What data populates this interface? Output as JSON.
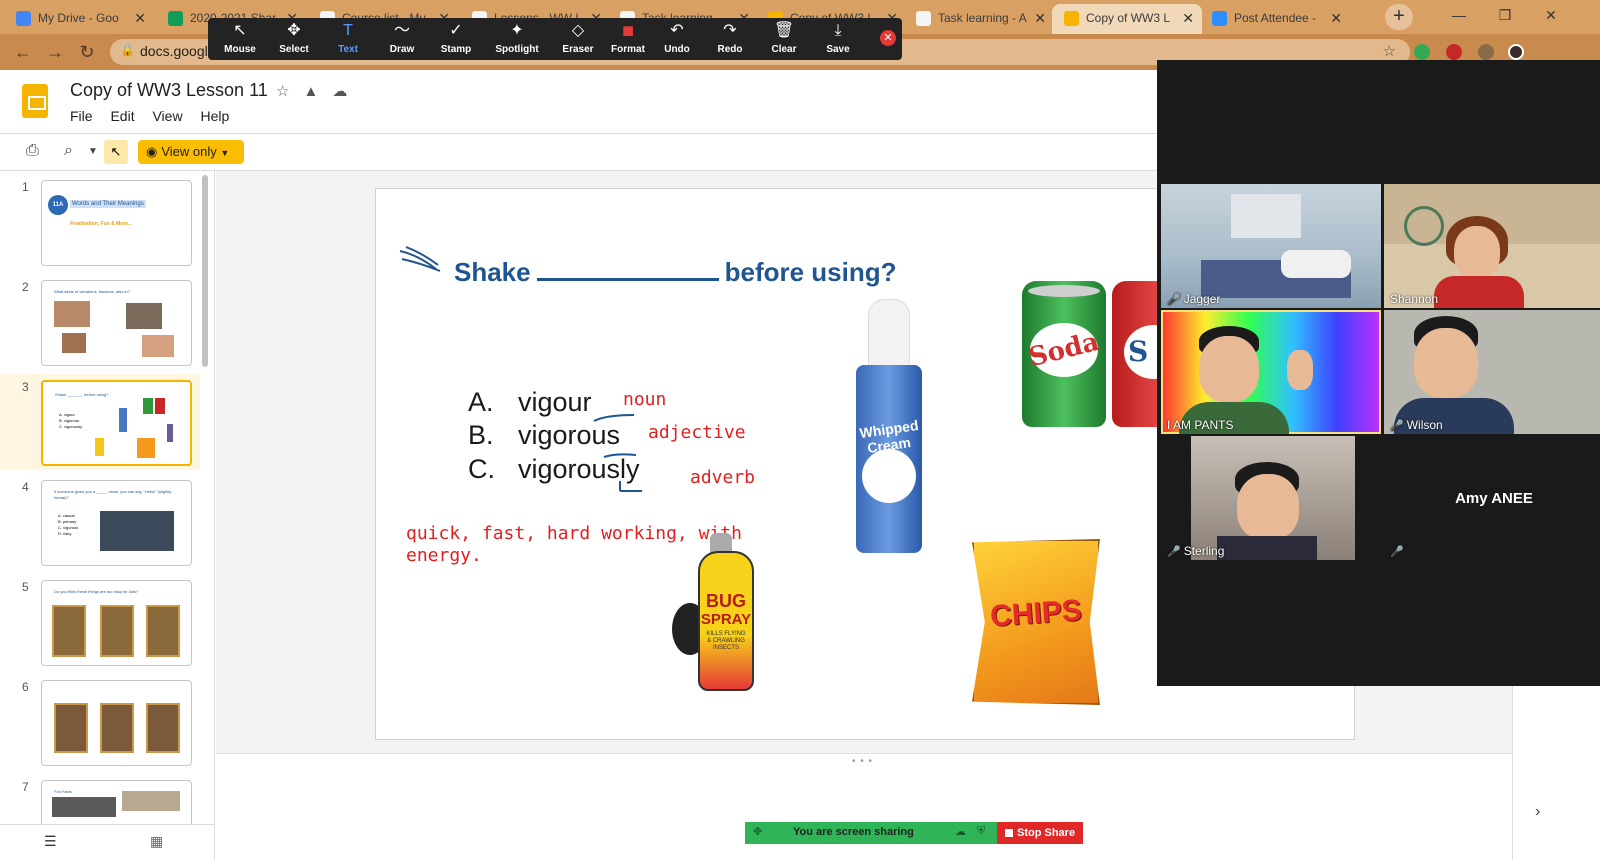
{
  "browser": {
    "tabs": [
      {
        "title": "My Drive - Goo",
        "fav": "#4285f4"
      },
      {
        "title": "2020-2021 Shar",
        "fav": "#0f9d58"
      },
      {
        "title": "Course list - Mu",
        "fav": "#f4f4f4"
      },
      {
        "title": "Lessons - WW L",
        "fav": "#f4f4f4"
      },
      {
        "title": "Task learning -",
        "fav": "#f4f4f4"
      },
      {
        "title": "Copy of WW3 L",
        "fav": "#f4b400"
      },
      {
        "title": "Task learning - A",
        "fav": "#f4f4f4"
      },
      {
        "title": "Copy of WW3 L",
        "fav": "#f4b400"
      },
      {
        "title": "Post Attendee -",
        "fav": "#2d8cff"
      }
    ],
    "new_tab": "+",
    "minimize": "—",
    "restore": "❐",
    "close": "✕",
    "url": "docs.googl",
    "accent": "#d9a064"
  },
  "annotate": {
    "tools": [
      {
        "label": "Mouse",
        "icon": "↖"
      },
      {
        "label": "Select",
        "icon": "✥"
      },
      {
        "label": "Text",
        "icon": "T"
      },
      {
        "label": "Draw",
        "icon": "〜"
      },
      {
        "label": "Stamp",
        "icon": "✓"
      },
      {
        "label": "Spotlight",
        "icon": "✦"
      },
      {
        "label": "Eraser",
        "icon": "◇"
      },
      {
        "label": "Format",
        "icon": "■"
      },
      {
        "label": "Undo",
        "icon": "↶"
      },
      {
        "label": "Redo",
        "icon": "↷"
      },
      {
        "label": "Clear",
        "icon": "🗑"
      },
      {
        "label": "Save",
        "icon": "⤓"
      }
    ],
    "close": "✕",
    "format_color": "#e53935"
  },
  "docs": {
    "title": "Copy of WW3 Lesson 11",
    "menu": [
      "File",
      "Edit",
      "View",
      "Help"
    ],
    "view_only": "View only",
    "brand_color": "#f4b400"
  },
  "filmstrip": {
    "slides": [
      {
        "num": "1",
        "thumb_title": "Words and Their Meanings",
        "thumb_sub": "Finalisation, Fun & More...",
        "badge": "11A"
      },
      {
        "num": "2",
        "thumb_title": "What kinds of vibrations, fractions, also in?"
      },
      {
        "num": "3",
        "thumb_title": "Shake _______ before using?",
        "thumb_opts": [
          "A. vigour",
          "B. vigorous",
          "C. vigorously"
        ],
        "selected": true
      },
      {
        "num": "4",
        "thumb_title": "If someone gives you a _____ clean, you can say, \"Hello!\" (slightly formal)?",
        "thumb_opts": [
          "A. casual",
          "B. primary",
          "C. vigorous",
          "D. risky"
        ]
      },
      {
        "num": "5",
        "thumb_title": "Do you think these things are too risky for kids?"
      },
      {
        "num": "6",
        "thumb_title": ""
      },
      {
        "num": "7",
        "thumb_title": "Fun Facts"
      }
    ]
  },
  "slide": {
    "title_pre": "Shake",
    "title_post": "before using?",
    "options": [
      {
        "letter": "A.",
        "word": "vigour"
      },
      {
        "letter": "B.",
        "word": "vigorous"
      },
      {
        "letter": "C.",
        "word": "vigorously"
      }
    ],
    "annotations": {
      "noun": "noun",
      "adjective": "adjective",
      "adverb": "adverb",
      "meaning_line1": "quick, fast, hard working, with",
      "meaning_line2": "energy."
    },
    "images": {
      "soda_label": "Soda",
      "soda2_label": "S",
      "cream_line1": "Whipped",
      "cream_line2": "Cream",
      "bug_line1": "BUG",
      "bug_line2": "SPRAY",
      "bug_sub": "KILLS FLYING & CRAWLING INSECTS",
      "chips_label": "CHIPS"
    }
  },
  "zoom": {
    "participants": [
      {
        "name": "Jagger"
      },
      {
        "name": "Shannon"
      },
      {
        "name": "I AM PANTS"
      },
      {
        "name": "Wilson"
      },
      {
        "name": "Sterling"
      },
      {
        "name": "Amy ANEE"
      }
    ]
  },
  "share": {
    "status": "You are screen sharing",
    "stop": "Stop Share"
  }
}
